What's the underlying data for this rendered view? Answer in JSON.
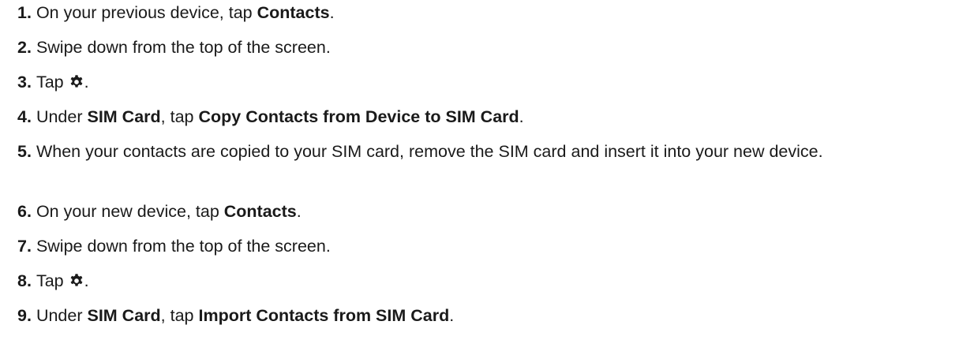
{
  "steps": [
    {
      "num": "1.",
      "parts": [
        {
          "text": "On your previous device, tap "
        },
        {
          "text": "Contacts",
          "bold": true
        },
        {
          "text": "."
        }
      ]
    },
    {
      "num": "2.",
      "parts": [
        {
          "text": "Swipe down from the top of the screen."
        }
      ]
    },
    {
      "num": "3.",
      "parts": [
        {
          "text": "Tap "
        },
        {
          "icon": "gear-icon"
        },
        {
          "text": "."
        }
      ]
    },
    {
      "num": "4.",
      "parts": [
        {
          "text": "Under "
        },
        {
          "text": "SIM Card",
          "bold": true
        },
        {
          "text": ", tap "
        },
        {
          "text": "Copy Contacts from Device to SIM Card",
          "bold": true
        },
        {
          "text": "."
        }
      ]
    },
    {
      "num": "5.",
      "parts": [
        {
          "text": "When your contacts are copied to your SIM card, remove the SIM card and insert it into your new device."
        }
      ]
    },
    {
      "num": "6.",
      "parts": [
        {
          "text": "On your new device, tap "
        },
        {
          "text": "Contacts",
          "bold": true
        },
        {
          "text": "."
        }
      ]
    },
    {
      "num": "7.",
      "parts": [
        {
          "text": "Swipe down from the top of the screen."
        }
      ]
    },
    {
      "num": "8.",
      "parts": [
        {
          "text": "Tap "
        },
        {
          "icon": "gear-icon"
        },
        {
          "text": "."
        }
      ]
    },
    {
      "num": "9.",
      "parts": [
        {
          "text": "Under "
        },
        {
          "text": "SIM Card",
          "bold": true
        },
        {
          "text": ", tap "
        },
        {
          "text": "Import Contacts from SIM Card",
          "bold": true
        },
        {
          "text": "."
        }
      ]
    }
  ]
}
